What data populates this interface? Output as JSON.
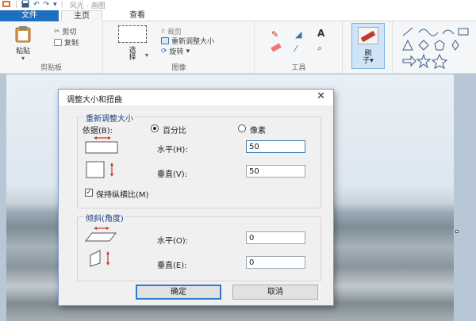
{
  "window": {
    "title": "风光 - 画图",
    "qat": {
      "app_icon": "paint-icon",
      "save_icon": "save-icon",
      "undo_icon": "undo-icon",
      "redo_icon": "redo-icon",
      "customize_icon": "dropdown-icon"
    }
  },
  "tabs": {
    "file": "文件",
    "home": "主页",
    "view": "查看"
  },
  "ribbon": {
    "clipboard": {
      "label": "剪贴板",
      "paste": "粘贴",
      "paste_arrow": "▾",
      "cut": "剪切",
      "copy": "复制"
    },
    "image": {
      "label": "图像",
      "select": "选",
      "select_line2": "择",
      "select_arrow": "▾",
      "crop": "裁剪",
      "resize": "重新调整大小",
      "rotate": "旋转",
      "rotate_arrow": "▾"
    },
    "tools": {
      "label": "工具"
    },
    "brushes": {
      "label_line1": "刷",
      "label_line2": "子▾"
    }
  },
  "dialog": {
    "title": "调整大小和扭曲",
    "close": "✕",
    "resize_section": {
      "legend": "重新调整大小",
      "by_label": "依据(B):",
      "percent": "百分比",
      "pixels": "像素",
      "horizontal_label": "水平(H):",
      "horizontal_value": "50",
      "vertical_label": "垂直(V):",
      "vertical_value": "50",
      "keep_ratio": "保持纵横比(M)",
      "keep_ratio_checked": true
    },
    "skew_section": {
      "legend": "倾斜(角度)",
      "horizontal_label": "水平(O):",
      "horizontal_value": "0",
      "vertical_label": "垂直(E):",
      "vertical_value": "0"
    },
    "ok": "确定",
    "cancel": "取消"
  },
  "colors": {
    "accent": "#1e6fbf",
    "legend": "#1e3f80"
  }
}
